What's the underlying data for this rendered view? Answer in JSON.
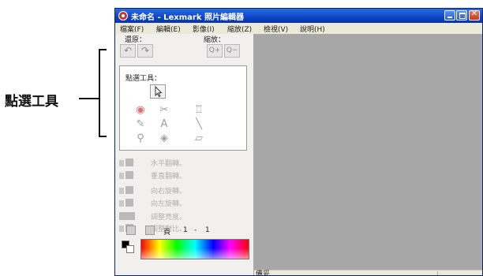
{
  "callout": {
    "label": "點選工具"
  },
  "window": {
    "title": "未命名 - Lexmark 照片編輯器",
    "buttons": {
      "minimize": "",
      "maximize": "",
      "close": "✕"
    }
  },
  "menu": [
    "檔案(F)",
    "編輯(E)",
    "影像(I)",
    "縮放(Z)",
    "檢視(V)",
    "說明(H)"
  ],
  "toolbar": {
    "undo_label": "還原：",
    "zoom_label": "縮放：",
    "zoom_in": "Q+",
    "zoom_out": "Q−"
  },
  "select_tools": {
    "title": "點選工具：",
    "text_tool": "A"
  },
  "options": [
    {
      "label": "水平翻轉。"
    },
    {
      "label": "垂直翻轉。"
    },
    {
      "label": "向右旋轉。"
    },
    {
      "label": "向左旋轉。"
    },
    {
      "label": "調整亮度。"
    },
    {
      "label": "調整對比。"
    }
  ],
  "page_nav": {
    "label": "頁",
    "current": "1",
    "separator": "-",
    "total": "1"
  },
  "colors": {
    "foreground": "#000000",
    "background": "#ffffff"
  },
  "status": {
    "text": "備妥"
  }
}
